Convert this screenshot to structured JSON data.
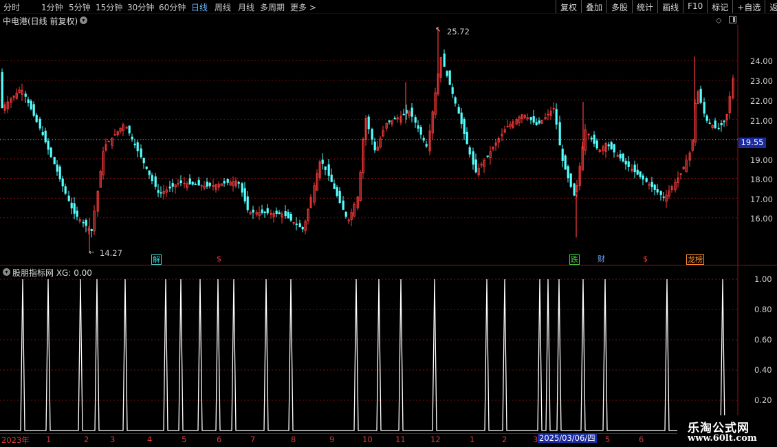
{
  "toolbar": {
    "periods": [
      "分时",
      "1分钟",
      "5分钟",
      "15分钟",
      "30分钟",
      "60分钟",
      "日线",
      "周线",
      "月线",
      "多周期",
      "更多 >"
    ],
    "active_period": "日线",
    "right_buttons": [
      "复权",
      "叠加",
      "多股",
      "统计",
      "画线",
      "F10",
      "标记",
      "+自选",
      "返回"
    ]
  },
  "chart": {
    "stock_title": "中电港(日线 前复权)",
    "high_label": "25.72",
    "low_label": "14.27",
    "current_price": "19.55",
    "price_axis": [
      "24.00",
      "23.00",
      "22.00",
      "21.00",
      "19.00",
      "18.00",
      "17.00",
      "16.00"
    ],
    "events": [
      {
        "label": "解",
        "color": "#40d0d0"
      },
      {
        "label": "$",
        "color": "#ff4040"
      },
      {
        "label": "跌",
        "color": "#40d040"
      },
      {
        "label": "财",
        "color": "#6fa8ff"
      },
      {
        "label": "$",
        "color": "#ff4040"
      },
      {
        "label": "龙榜",
        "color": "#ff9030"
      }
    ]
  },
  "indicator": {
    "title": "股朋指标网 XG: 0.00",
    "axis": [
      "1.00",
      "0.80",
      "0.60",
      "0.40",
      "0.20"
    ]
  },
  "date_axis": {
    "labels": [
      "2023年",
      "1",
      "2",
      "3",
      "4",
      "5",
      "6",
      "7",
      "8",
      "9",
      "10",
      "11",
      "12",
      "1",
      "2",
      "3",
      "5",
      "6"
    ],
    "cursor_date": "2025/03/06/四"
  },
  "watermark": {
    "line1": "乐淘公式网",
    "line2": "www.60lt.com"
  },
  "colors": {
    "up": "#ff3c3c",
    "down": "#54ffff",
    "grid": "#7a1010",
    "axis": "#a01010",
    "accent": "#1a2aa0"
  }
}
